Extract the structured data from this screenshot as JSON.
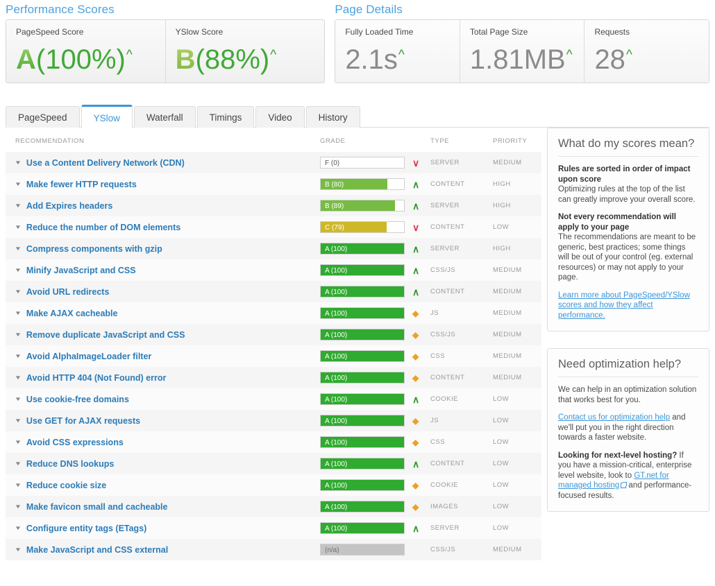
{
  "performance": {
    "heading": "Performance Scores",
    "cards": [
      {
        "label": "PageSpeed Score",
        "letter": "A",
        "value": "(100%)",
        "trend": "^"
      },
      {
        "label": "YSlow Score",
        "letter": "B",
        "value": "(88%)",
        "trend": "^"
      }
    ]
  },
  "page_details": {
    "heading": "Page Details",
    "cards": [
      {
        "label": "Fully Loaded Time",
        "value": "2.1s",
        "trend": "^"
      },
      {
        "label": "Total Page Size",
        "value": "1.81MB",
        "trend": "^"
      },
      {
        "label": "Requests",
        "value": "28",
        "trend": "^"
      }
    ]
  },
  "tabs": [
    {
      "label": "PageSpeed",
      "active": false
    },
    {
      "label": "YSlow",
      "active": true
    },
    {
      "label": "Waterfall",
      "active": false
    },
    {
      "label": "Timings",
      "active": false
    },
    {
      "label": "Video",
      "active": false
    },
    {
      "label": "History",
      "active": false
    }
  ],
  "table": {
    "headers": {
      "recommendation": "RECOMMENDATION",
      "grade": "GRADE",
      "type": "TYPE",
      "priority": "PRIORITY"
    },
    "rows": [
      {
        "name": "Use a Content Delivery Network (CDN)",
        "grade": "F (0)",
        "score": 0,
        "band": "f",
        "arrow": "down",
        "type": "SERVER",
        "priority": "MEDIUM"
      },
      {
        "name": "Make fewer HTTP requests",
        "grade": "B (80)",
        "score": 80,
        "band": "b",
        "arrow": "up",
        "type": "CONTENT",
        "priority": "HIGH"
      },
      {
        "name": "Add Expires headers",
        "grade": "B (89)",
        "score": 89,
        "band": "b",
        "arrow": "up",
        "type": "SERVER",
        "priority": "HIGH"
      },
      {
        "name": "Reduce the number of DOM elements",
        "grade": "C (79)",
        "score": 79,
        "band": "c",
        "arrow": "down",
        "type": "CONTENT",
        "priority": "LOW"
      },
      {
        "name": "Compress components with gzip",
        "grade": "A (100)",
        "score": 100,
        "band": "a",
        "arrow": "up",
        "type": "SERVER",
        "priority": "HIGH"
      },
      {
        "name": "Minify JavaScript and CSS",
        "grade": "A (100)",
        "score": 100,
        "band": "a",
        "arrow": "up",
        "type": "CSS/JS",
        "priority": "MEDIUM"
      },
      {
        "name": "Avoid URL redirects",
        "grade": "A (100)",
        "score": 100,
        "band": "a",
        "arrow": "up",
        "type": "CONTENT",
        "priority": "MEDIUM"
      },
      {
        "name": "Make AJAX cacheable",
        "grade": "A (100)",
        "score": 100,
        "band": "a",
        "arrow": "flat",
        "type": "JS",
        "priority": "MEDIUM"
      },
      {
        "name": "Remove duplicate JavaScript and CSS",
        "grade": "A (100)",
        "score": 100,
        "band": "a",
        "arrow": "flat",
        "type": "CSS/JS",
        "priority": "MEDIUM"
      },
      {
        "name": "Avoid AlphaImageLoader filter",
        "grade": "A (100)",
        "score": 100,
        "band": "a",
        "arrow": "flat",
        "type": "CSS",
        "priority": "MEDIUM"
      },
      {
        "name": "Avoid HTTP 404 (Not Found) error",
        "grade": "A (100)",
        "score": 100,
        "band": "a",
        "arrow": "flat",
        "type": "CONTENT",
        "priority": "MEDIUM"
      },
      {
        "name": "Use cookie-free domains",
        "grade": "A (100)",
        "score": 100,
        "band": "a",
        "arrow": "up",
        "type": "COOKIE",
        "priority": "LOW"
      },
      {
        "name": "Use GET for AJAX requests",
        "grade": "A (100)",
        "score": 100,
        "band": "a",
        "arrow": "flat",
        "type": "JS",
        "priority": "LOW"
      },
      {
        "name": "Avoid CSS expressions",
        "grade": "A (100)",
        "score": 100,
        "band": "a",
        "arrow": "flat",
        "type": "CSS",
        "priority": "LOW"
      },
      {
        "name": "Reduce DNS lookups",
        "grade": "A (100)",
        "score": 100,
        "band": "a",
        "arrow": "up",
        "type": "CONTENT",
        "priority": "LOW"
      },
      {
        "name": "Reduce cookie size",
        "grade": "A (100)",
        "score": 100,
        "band": "a",
        "arrow": "flat",
        "type": "COOKIE",
        "priority": "LOW"
      },
      {
        "name": "Make favicon small and cacheable",
        "grade": "A (100)",
        "score": 100,
        "band": "a",
        "arrow": "flat",
        "type": "IMAGES",
        "priority": "LOW"
      },
      {
        "name": "Configure entity tags (ETags)",
        "grade": "A (100)",
        "score": 100,
        "band": "a",
        "arrow": "up",
        "type": "SERVER",
        "priority": "LOW"
      },
      {
        "name": "Make JavaScript and CSS external",
        "grade": "(n/a)",
        "score": 0,
        "band": "na",
        "arrow": "",
        "type": "CSS/JS",
        "priority": "MEDIUM"
      }
    ]
  },
  "aside": {
    "scores_panel": {
      "title": "What do my scores mean?",
      "b1": "Rules are sorted in order of impact upon score",
      "t1": "Optimizing rules at the top of the list can greatly improve your overall score.",
      "b2": "Not every recommendation will apply to your page",
      "t2": "The recommendations are meant to be generic, best practices; some things will be out of your control (eg. external resources) or may not apply to your page.",
      "link": "Learn more about PageSpeed/YSlow scores and how they affect performance."
    },
    "help_panel": {
      "title": "Need optimization help?",
      "t1": "We can help in an optimization solution that works best for you.",
      "link1": "Contact us for optimization help",
      "t2": " and we'll put you in the right direction towards a faster website.",
      "b2": "Looking for next-level hosting?",
      "t3": " If you have a mission-critical, enterprise level website, look to ",
      "link2": "GT.net for managed hosting",
      "t4": " and performance-focused results."
    }
  },
  "icons": {
    "caret": "▼",
    "arrow_up": "∧",
    "arrow_down": "∨",
    "arrow_flat": "◆"
  }
}
